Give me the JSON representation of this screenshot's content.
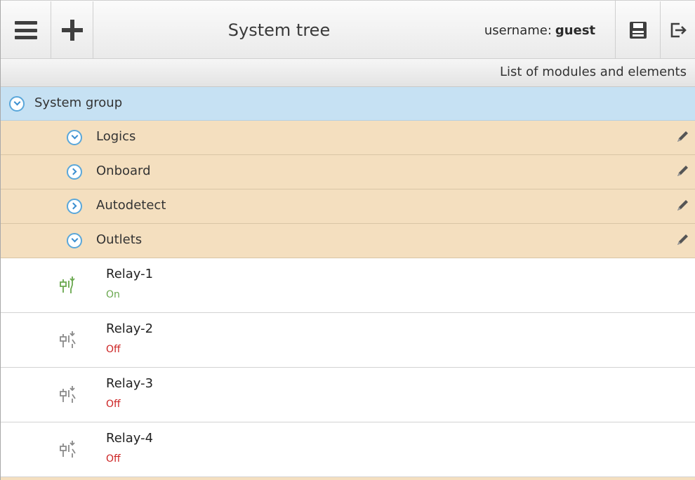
{
  "toolbar": {
    "menu_icon": "hamburger-menu-icon",
    "add_icon": "plus-icon",
    "title": "System tree",
    "username_label": "username:",
    "username_value": "guest",
    "save_icon": "floppy-disk-icon",
    "exit_icon": "logout-icon"
  },
  "subheader": {
    "text": "List of modules and elements"
  },
  "tree": {
    "group": {
      "label": "System group",
      "expanded": true
    },
    "folders": [
      {
        "label": "Logics",
        "expanded": true
      },
      {
        "label": "Onboard",
        "expanded": false
      },
      {
        "label": "Autodetect",
        "expanded": false
      },
      {
        "label": "Outlets",
        "expanded": true
      }
    ],
    "elements": [
      {
        "name": "Relay-1",
        "state": "On"
      },
      {
        "name": "Relay-2",
        "state": "Off"
      },
      {
        "name": "Relay-3",
        "state": "Off"
      },
      {
        "name": "Relay-4",
        "state": "Off"
      }
    ]
  },
  "colors": {
    "on": "#6aa84f",
    "off": "#cc2222",
    "icon_off": "#8a8a8a",
    "group_bg": "#c6e1f3",
    "folder_bg": "#f4dfbf"
  }
}
